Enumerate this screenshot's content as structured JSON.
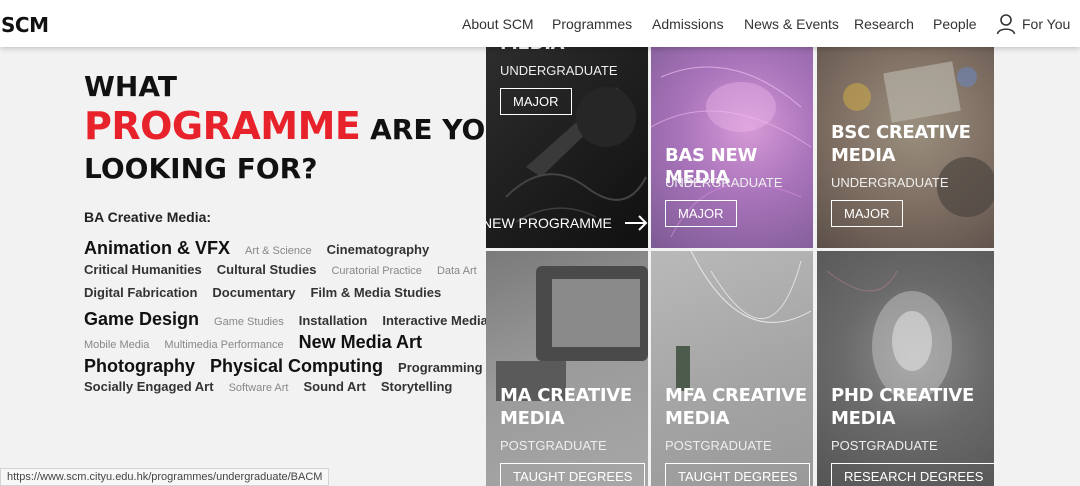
{
  "header": {
    "logo": "SCM",
    "nav": [
      "About SCM",
      "Programmes",
      "Admissions",
      "News & Events",
      "Research",
      "People"
    ],
    "for_you": "For You"
  },
  "hero": {
    "line1": "WHAT",
    "line2_red": "PROGRAMME",
    "line2_rest": "ARE YOU",
    "line3": "LOOKING FOR?"
  },
  "ba_label": "BA Creative Media:",
  "tags": [
    [
      {
        "t": "Animation & VFX",
        "s": "xl"
      },
      {
        "t": "Art & Science",
        "s": "sm"
      },
      {
        "t": "Cinematography",
        "s": "md"
      }
    ],
    [
      {
        "t": "Critical Humanities",
        "s": "md"
      },
      {
        "t": "Cultural Studies",
        "s": "md"
      },
      {
        "t": "Curatorial Practice",
        "s": "sm"
      },
      {
        "t": "Data Art",
        "s": "sm"
      }
    ],
    [
      {
        "t": "Digital Fabrication",
        "s": "md"
      },
      {
        "t": "Documentary",
        "s": "md"
      },
      {
        "t": "Film & Media Studies",
        "s": "md"
      }
    ],
    [
      {
        "t": "Game Design",
        "s": "xl"
      },
      {
        "t": "Game Studies",
        "s": "sm"
      },
      {
        "t": "Installation",
        "s": "md"
      },
      {
        "t": "Interactive Media",
        "s": "md"
      }
    ],
    [
      {
        "t": "Mobile Media",
        "s": "sm"
      },
      {
        "t": "Multimedia Performance",
        "s": "sm"
      },
      {
        "t": "New Media Art",
        "s": "xl"
      }
    ],
    [
      {
        "t": "Photography",
        "s": "xl"
      },
      {
        "t": "Physical Computing",
        "s": "xl"
      },
      {
        "t": "Programming",
        "s": "md"
      }
    ],
    [
      {
        "t": "Socially Engaged Art",
        "s": "md"
      },
      {
        "t": "Software Art",
        "s": "sm"
      },
      {
        "t": "Sound Art",
        "s": "md"
      },
      {
        "t": "Storytelling",
        "s": "md"
      }
    ]
  ],
  "tiles": {
    "t1": {
      "title": "MEDIA",
      "sub": "UNDERGRADUATE",
      "btn": "MAJOR",
      "link": "NEW PROGRAMME"
    },
    "t2": {
      "title": "BAS NEW MEDIA",
      "sub": "UNDERGRADUATE",
      "btn": "MAJOR"
    },
    "t3": {
      "title1": "BSC CREATIVE",
      "title2": "MEDIA",
      "sub": "UNDERGRADUATE",
      "btn": "MAJOR"
    },
    "t4": {
      "title1": "MA CREATIVE",
      "title2": "MEDIA",
      "sub": "POSTGRADUATE",
      "btn": "TAUGHT DEGREES"
    },
    "t5": {
      "title1": "MFA CREATIVE",
      "title2": "MEDIA",
      "sub": "POSTGRADUATE",
      "btn": "TAUGHT DEGREES"
    },
    "t6": {
      "title1": "PHD CREATIVE",
      "title2": "MEDIA",
      "sub": "POSTGRADUATE",
      "btn": "RESEARCH DEGREES"
    }
  },
  "status_url": "https://www.scm.cityu.edu.hk/programmes/undergraduate/BACM"
}
